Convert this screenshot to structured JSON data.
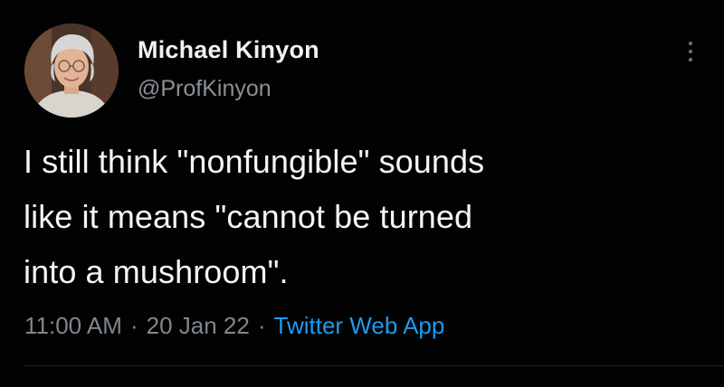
{
  "tweet": {
    "author": {
      "name": "Michael Kinyon",
      "handle": "@ProfKinyon",
      "avatar_icon": "profile-photo"
    },
    "text_lines": [
      "I still think \"nonfungible\" sounds",
      "like it means \"cannot be turned",
      "into a mushroom\"."
    ],
    "time": "11:00 AM",
    "separator": "·",
    "date": "20 Jan 22",
    "source": "Twitter Web App",
    "more_icon": "more-vertical-icon"
  },
  "colors": {
    "background": "#000000",
    "primary_text": "#f4f5f6",
    "secondary_text": "#80868c",
    "link": "#1d9bf0"
  }
}
